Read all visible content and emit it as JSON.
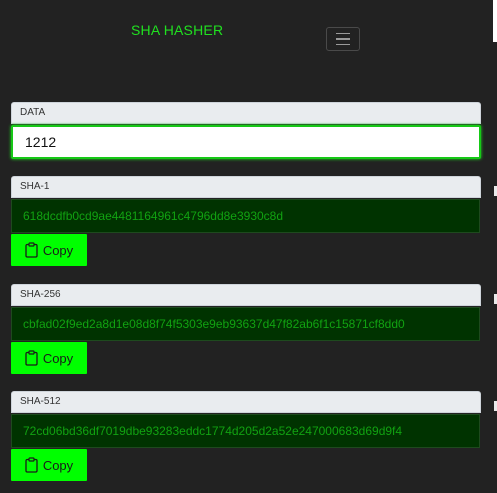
{
  "navbar": {
    "brand": "SHA HASHER",
    "toggle_icon": "hamburger-menu-icon",
    "brand_color": "#20e020"
  },
  "data_section": {
    "label": "DATA",
    "value": "1212"
  },
  "hashes": [
    {
      "label": "SHA-1",
      "value": "618dcdfb0cd9ae4481164961c4796dd8e3930c8d",
      "copy_label": "Copy"
    },
    {
      "label": "SHA-256",
      "value": "cbfad02f9ed2a8d1e08d8f74f5303e9eb93637d47f82ab6f1c15871cf8dd0",
      "copy_label": "Copy"
    },
    {
      "label": "SHA-512",
      "value": "72cd06bd36df7019dbe93283eddc1774d205d2a52e247000683d69d9f4",
      "copy_label": "Copy"
    }
  ],
  "colors": {
    "background": "#222222",
    "accent": "#00ff00",
    "hash_bg": "#003300",
    "hash_text": "#11a211"
  },
  "icons": {
    "copy": "clipboard-icon"
  }
}
